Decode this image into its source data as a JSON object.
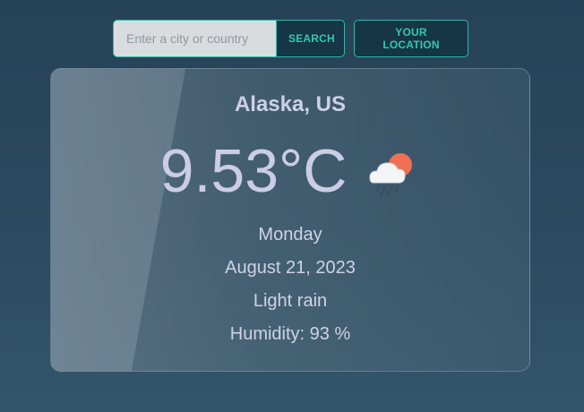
{
  "search": {
    "placeholder": "Enter a city or country",
    "value": "",
    "search_label": "SEARCH",
    "location_label": "YOUR LOCATION"
  },
  "weather": {
    "location": "Alaska, US",
    "temperature": "9.53°C",
    "icon": "light-rain-sun-cloud-icon",
    "day": "Monday",
    "date": "August 21, 2023",
    "description": "Light rain",
    "humidity": "Humidity: 93 %"
  },
  "colors": {
    "accent": "#2fb8a8",
    "button_bg": "#163545",
    "text": "#cdd0e6",
    "sun": "#f07054"
  }
}
